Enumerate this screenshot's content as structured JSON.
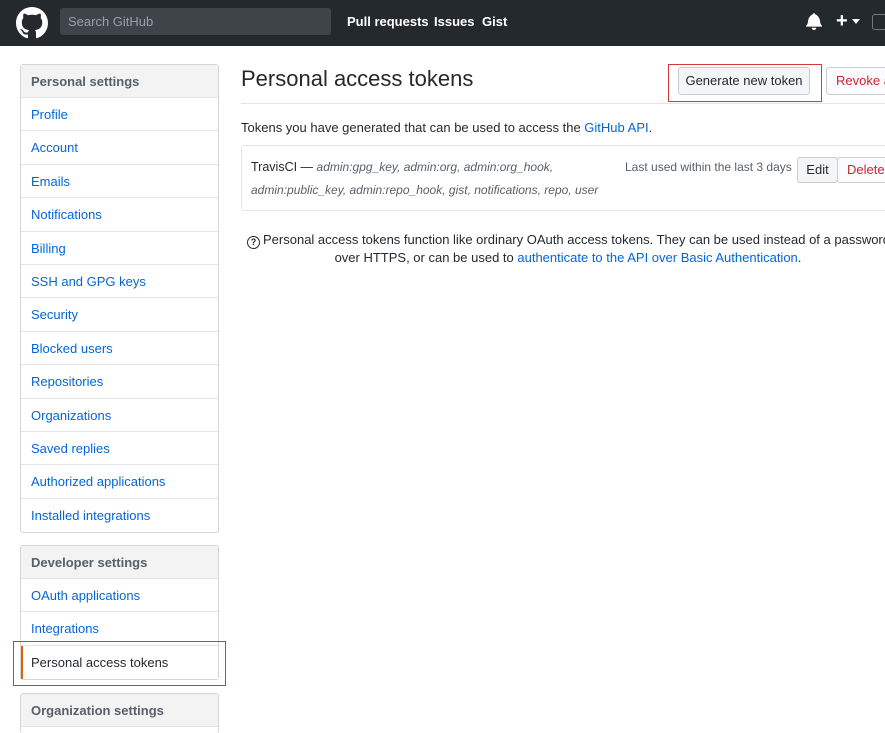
{
  "header": {
    "logo": "github-octocat-icon",
    "search_placeholder": "Search GitHub",
    "nav": [
      "Pull requests",
      "Issues",
      "Gist"
    ],
    "icons": [
      "bell-icon",
      "plus-icon",
      "caret-down-icon"
    ]
  },
  "sidebar": {
    "personal": {
      "heading": "Personal settings",
      "items": [
        "Profile",
        "Account",
        "Emails",
        "Notifications",
        "Billing",
        "SSH and GPG keys",
        "Security",
        "Blocked users",
        "Repositories",
        "Organizations",
        "Saved replies",
        "Authorized applications",
        "Installed integrations"
      ]
    },
    "developer": {
      "heading": "Developer settings",
      "items": [
        "OAuth applications",
        "Integrations",
        "Personal access tokens"
      ]
    },
    "organization": {
      "heading": "Organization settings"
    }
  },
  "main": {
    "title": "Personal access tokens",
    "generate_button": "Generate new token",
    "revoke_button": "Revoke a",
    "intro_prefix": "Tokens you have generated that can be used to access the ",
    "intro_link": "GitHub API",
    "intro_suffix": ".",
    "token": {
      "name": "TravisCI",
      "separator": " — ",
      "scopes_line1": "admin:gpg_key, admin:org, admin:org_hook,",
      "scopes_line2": "admin:public_key, admin:repo_hook, gist, notifications, repo, user",
      "last_used": "Last used within the last 3 days",
      "edit_button": "Edit",
      "delete_button": "Delete"
    },
    "note": {
      "line1": "Personal access tokens function like ordinary OAuth access tokens. They can be used instead of a password for G",
      "line2_prefix": "over HTTPS, or can be used to ",
      "line2_link": "authenticate to the API over Basic Authentication",
      "line2_suffix": "."
    }
  },
  "colors": {
    "header_bg": "#24292e",
    "link": "#0366d6",
    "selected_accent": "#e36209",
    "highlight_box": "#d53a3a",
    "danger": "#cb2431"
  }
}
